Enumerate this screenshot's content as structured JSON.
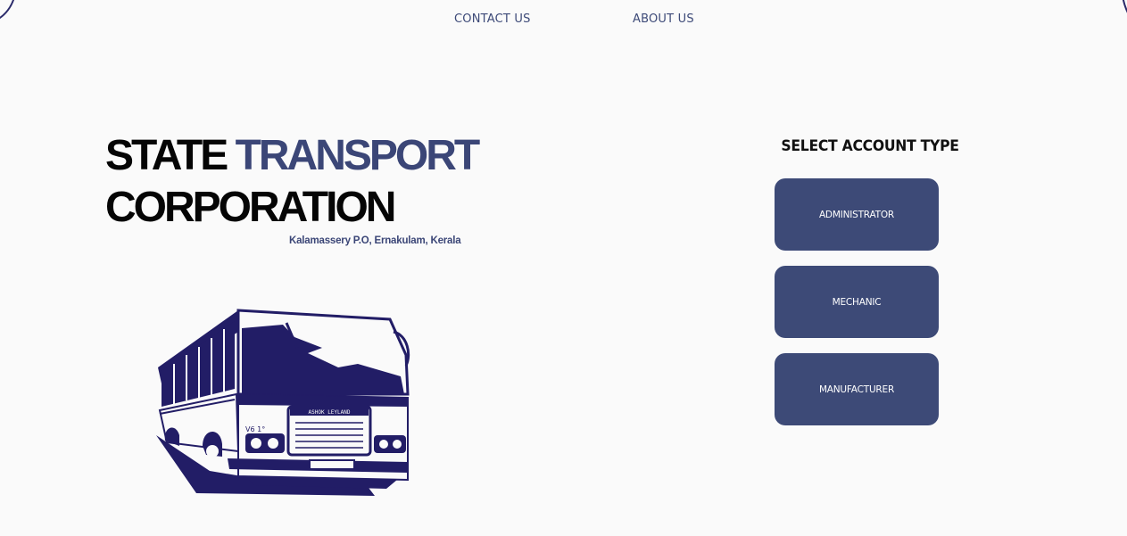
{
  "nav": {
    "contact_label": "CONTACT US",
    "about_label": "ABOUT US"
  },
  "hero": {
    "title_word1": "STATE",
    "title_word2": "TRANSPORT",
    "title_line2": "CORPORATION",
    "subtitle": "Kalamassery P.O, Ernakulam, Kerala",
    "bus_front_sign": "ASHOK LEYLAND",
    "bus_side_text": "V6 1°"
  },
  "account": {
    "heading": "SELECT ACCOUNT TYPE",
    "options": [
      {
        "label": "ADMINISTRATOR"
      },
      {
        "label": "MECHANIC"
      },
      {
        "label": "MANUFACTURER"
      }
    ]
  },
  "colors": {
    "accent": "#3b4677",
    "button": "#3d4a77",
    "bus": "#221d66",
    "background": "#fafafa"
  }
}
